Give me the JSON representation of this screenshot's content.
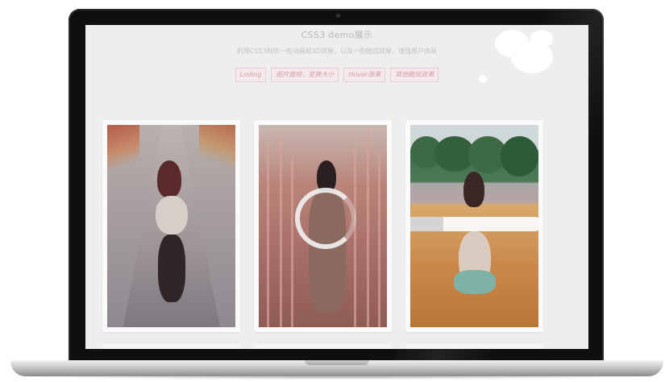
{
  "page": {
    "title": "CSS3 demo展示",
    "subtitle": "利用CSS3制作一些动画和3D效果，以及一些酷炫效果，增强用户体验"
  },
  "tabs": [
    {
      "label": "Loding"
    },
    {
      "label": "图片旋转、变换大小"
    },
    {
      "label": "Hover效果"
    },
    {
      "label": "其他酷炫效果"
    }
  ],
  "gallery": {
    "cards": [
      {
        "name": "road-photo"
      },
      {
        "name": "reeds-photo",
        "spinner": "loading-ring"
      },
      {
        "name": "field-photo",
        "progress_fraction": 0.25
      }
    ]
  },
  "colors": {
    "screen_bg": "#efeded",
    "tab_text": "#d79aa8",
    "tab_border": "#e6cdd3",
    "laptop_bezel": "#0f0f10"
  }
}
